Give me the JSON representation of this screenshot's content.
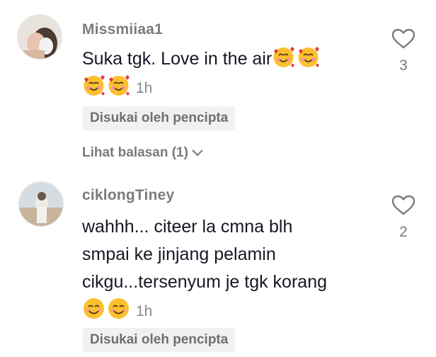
{
  "comments": [
    {
      "username": "Missmiiaa1",
      "text_line1": "Suka tgk. Love in the air",
      "time": "1h",
      "badge": "Disukai oleh pencipta",
      "replies_label": "Lihat balasan (1)",
      "like_count": "3",
      "avatar_icon": "avatar-photo",
      "emoji": "smiling-face-with-hearts"
    },
    {
      "username": "ciklongTiney",
      "text_lines": [
        "wahhh... citeer la cmna blh",
        "smpai ke jinjang pelamin",
        "cikgu...tersenyum je tgk korang"
      ],
      "time": "1h",
      "badge": "Disukai oleh pencipta",
      "like_count": "2",
      "avatar_icon": "avatar-photo",
      "emoji": "smiling-face-with-smiling-eyes"
    }
  ],
  "colors": {
    "username": "#7b7b7b",
    "text": "#161823",
    "badge_bg": "#f1f1f2",
    "emoji_yellow": "#fbc02d"
  }
}
